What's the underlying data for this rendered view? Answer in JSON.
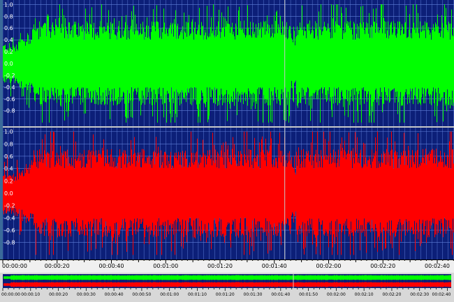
{
  "editor": {
    "colors": {
      "background": "#0c1f78",
      "grid": "#5f7fd8",
      "left_channel": "#00ff00",
      "right_channel": "#ff0000",
      "divider": "#c8c8c8",
      "playhead": "#c8c8c8"
    },
    "channels": [
      {
        "name_icon": "waveform-left-channel",
        "amplitude_labels": [
          "1.0",
          "0.8",
          "0.6",
          "0.4",
          "0.2",
          "0.0",
          "-0.2",
          "-0.4",
          "-0.6",
          "-0.8"
        ]
      },
      {
        "name_icon": "waveform-right-channel",
        "amplitude_labels": [
          "1.0",
          "0.8",
          "0.6",
          "0.4",
          "0.2",
          "0.0",
          "-0.2",
          "-0.4",
          "-0.6",
          "-0.8"
        ]
      }
    ],
    "timeline": {
      "labels": [
        "00:00:00",
        "00:00:20",
        "00:00:40",
        "00:01:00",
        "00:01:20",
        "00:01:40",
        "00:02:00",
        "00:02:20",
        "00:02:40"
      ]
    },
    "overview": {
      "labels": [
        "00:00:00",
        "00:00:10",
        "00:00:20",
        "00:00:30",
        "00:00:40",
        "00:00:50",
        "00:01:00",
        "00:01:10",
        "00:01:20",
        "00:01:30",
        "00:01:40",
        "00:01:50",
        "00:02:00",
        "00:02:10",
        "00:02:20",
        "00:02:30",
        "00:02:40"
      ]
    },
    "playhead_time_fraction": 0.649
  }
}
